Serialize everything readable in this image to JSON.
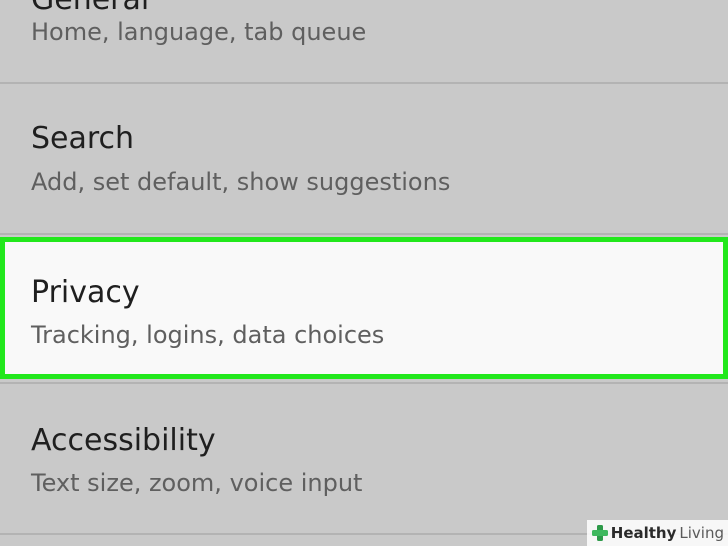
{
  "settings": {
    "items": [
      {
        "title": "General",
        "subtitle": "Home, language, tab queue"
      },
      {
        "title": "Search",
        "subtitle": "Add, set default, show suggestions"
      },
      {
        "title": "Privacy",
        "subtitle": "Tracking, logins, data choices"
      },
      {
        "title": "Accessibility",
        "subtitle": "Text size, zoom, voice input"
      }
    ],
    "highlight_color": "#22e81c"
  },
  "watermark": {
    "brand_strong": "Healthy",
    "brand_light": "Living",
    "logo_icon": "green-cross-icon"
  }
}
